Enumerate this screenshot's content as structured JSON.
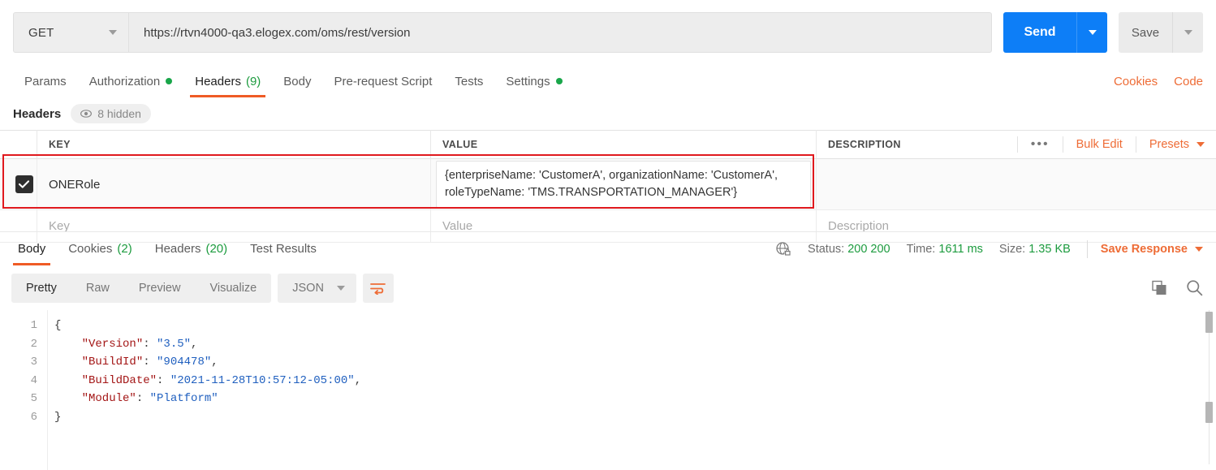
{
  "request": {
    "method": "GET",
    "url": "https://rtvn4000-qa3.elogex.com/oms/rest/version",
    "send_label": "Send",
    "save_label": "Save"
  },
  "request_tabs": [
    {
      "label": "Params",
      "active": false,
      "dot": false,
      "count": ""
    },
    {
      "label": "Authorization",
      "active": false,
      "dot": true,
      "count": ""
    },
    {
      "label": "Headers",
      "active": true,
      "dot": false,
      "count": "(9)"
    },
    {
      "label": "Body",
      "active": false,
      "dot": false,
      "count": ""
    },
    {
      "label": "Pre-request Script",
      "active": false,
      "dot": false,
      "count": ""
    },
    {
      "label": "Tests",
      "active": false,
      "dot": false,
      "count": ""
    },
    {
      "label": "Settings",
      "active": false,
      "dot": true,
      "count": ""
    }
  ],
  "tabs_right": {
    "cookies": "Cookies",
    "code": "Code"
  },
  "headers_section": {
    "title": "Headers",
    "hidden_badge": "8 hidden",
    "columns": {
      "key": "KEY",
      "value": "VALUE",
      "description": "DESCRIPTION"
    },
    "actions": {
      "ellipsis": "•••",
      "bulk_edit": "Bulk Edit",
      "presets": "Presets"
    },
    "rows": [
      {
        "checked": true,
        "key": "ONERole",
        "value": "{enterpriseName: 'CustomerA', organizationName: 'CustomerA', roleTypeName: 'TMS.TRANSPORTATION_MANAGER'}",
        "description": ""
      }
    ],
    "placeholders": {
      "key": "Key",
      "value": "Value",
      "description": "Description"
    }
  },
  "response_tabs": [
    {
      "label": "Body",
      "active": true,
      "count": ""
    },
    {
      "label": "Cookies",
      "active": false,
      "count": "(2)"
    },
    {
      "label": "Headers",
      "active": false,
      "count": "(20)"
    },
    {
      "label": "Test Results",
      "active": false,
      "count": ""
    }
  ],
  "response_meta": {
    "status_label": "Status:",
    "status_value": "200 200",
    "time_label": "Time:",
    "time_value": "1611 ms",
    "size_label": "Size:",
    "size_value": "1.35 KB",
    "save_response": "Save Response"
  },
  "body_toolbar": {
    "views": [
      {
        "label": "Pretty",
        "active": true
      },
      {
        "label": "Raw",
        "active": false
      },
      {
        "label": "Preview",
        "active": false
      },
      {
        "label": "Visualize",
        "active": false
      }
    ],
    "format": "JSON"
  },
  "response_body": {
    "line_numbers": [
      "1",
      "2",
      "3",
      "4",
      "5",
      "6"
    ],
    "lines": [
      {
        "indent": 0,
        "open": "{"
      },
      {
        "indent": 1,
        "key": "\"Version\"",
        "value": "\"3.5\"",
        "comma": ","
      },
      {
        "indent": 1,
        "key": "\"BuildId\"",
        "value": "\"904478\"",
        "comma": ","
      },
      {
        "indent": 1,
        "key": "\"BuildDate\"",
        "value": "\"2021-11-28T10:57:12-05:00\"",
        "comma": ","
      },
      {
        "indent": 1,
        "key": "\"Module\"",
        "value": "\"Platform\"",
        "comma": ""
      },
      {
        "indent": 0,
        "close": "}"
      }
    ],
    "raw": "{\n    \"Version\": \"3.5\",\n    \"BuildId\": \"904478\",\n    \"BuildDate\": \"2021-11-28T10:57:12-05:00\",\n    \"Module\": \"Platform\"\n}"
  },
  "colors": {
    "accent_orange": "#ee6c36",
    "send_blue": "#0d7ef7",
    "status_green": "#1c9b3e",
    "annotation_red": "#e0191e"
  }
}
